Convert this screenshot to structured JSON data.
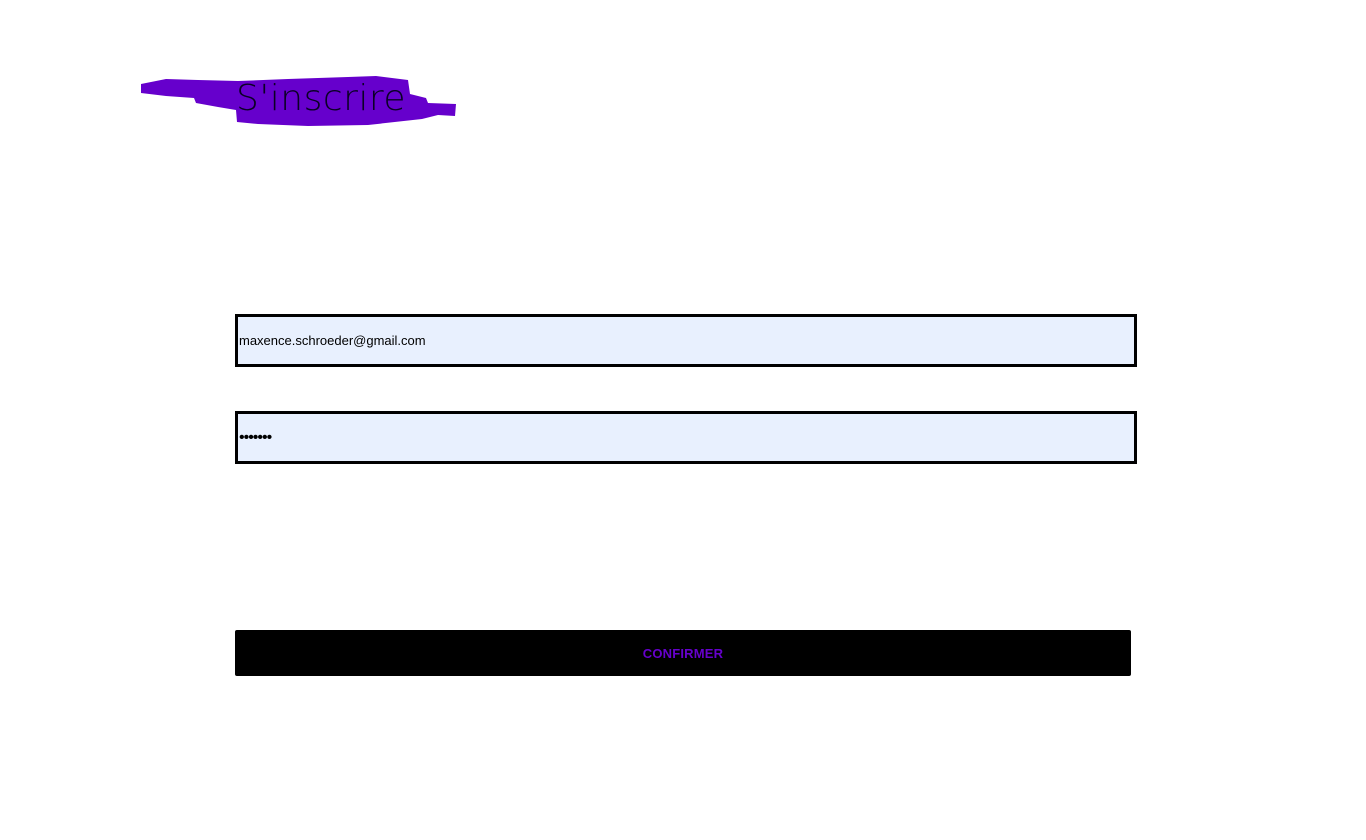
{
  "page": {
    "title": "S'inscrire"
  },
  "form": {
    "email_value": "maxence.schroeder@gmail.com",
    "password_value": "*******",
    "confirm_label": "CONFIRMER"
  },
  "colors": {
    "accent": "#6600cc",
    "field_background": "#e8f0fe",
    "button_background": "#000000"
  },
  "icons": {
    "title_decoration": "brush-stroke"
  }
}
